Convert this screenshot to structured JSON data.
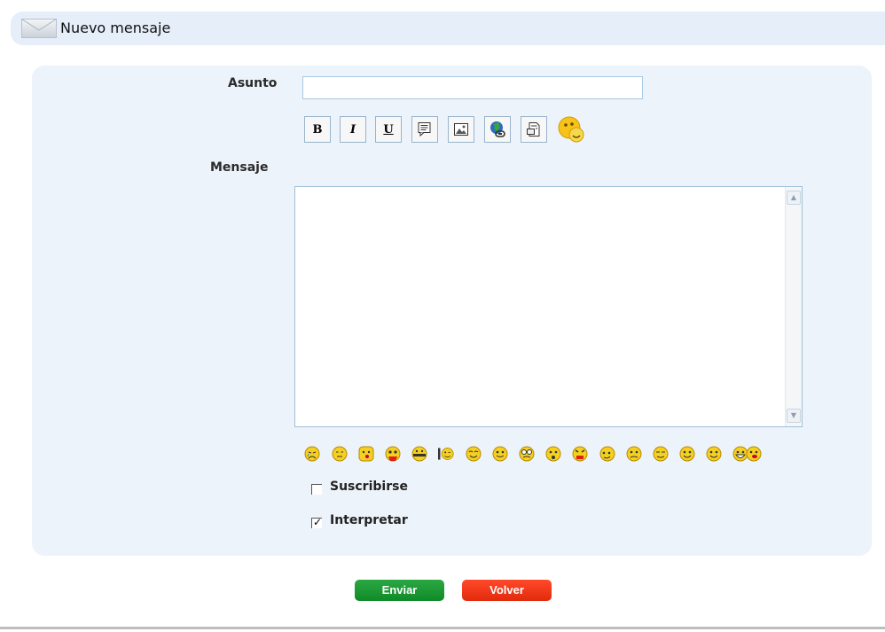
{
  "header": {
    "title": "Nuevo mensaje",
    "icon": "envelope-icon"
  },
  "form": {
    "subject_label": "Asunto",
    "subject_value": "",
    "message_label": "Mensaje",
    "message_value": ""
  },
  "toolbar": {
    "buttons": [
      {
        "name": "bold-button",
        "label": "B",
        "icon": "bold-icon"
      },
      {
        "name": "italic-button",
        "label": "I",
        "icon": "italic-icon"
      },
      {
        "name": "underline-button",
        "label": "U",
        "icon": "underline-icon"
      },
      {
        "name": "quote-button",
        "icon": "quote-icon"
      },
      {
        "name": "image-button",
        "icon": "image-icon"
      },
      {
        "name": "link-button",
        "icon": "globe-link-icon"
      },
      {
        "name": "code-button",
        "icon": "document-icon"
      },
      {
        "name": "smiley-button",
        "icon": "smiley-palette-icon"
      }
    ]
  },
  "smileys": [
    "crying-icon",
    "sad-icon",
    "blush-icon",
    "shocked-icon",
    "mouth-shut-icon",
    "wink-icon",
    "happy-icon",
    "grin-icon",
    "confused-icon",
    "surprised-icon",
    "worried-icon",
    "angry-icon",
    "smile-icon",
    "frown-icon",
    "cool-icon",
    "laugh-icon",
    "big-smile-icon",
    "kiss-icon"
  ],
  "options": {
    "subscribe": {
      "label": "Suscribirse",
      "checked": false
    },
    "interpret": {
      "label": "Interpretar",
      "checked": true
    }
  },
  "actions": {
    "send_label": "Enviar",
    "back_label": "Volver"
  },
  "colors": {
    "header_bg": "#e6eefa",
    "panel_bg": "#edf3fb",
    "send_button": "#1a9a33",
    "back_button": "#f2391a",
    "smiley_yellow": "#f5d020"
  }
}
